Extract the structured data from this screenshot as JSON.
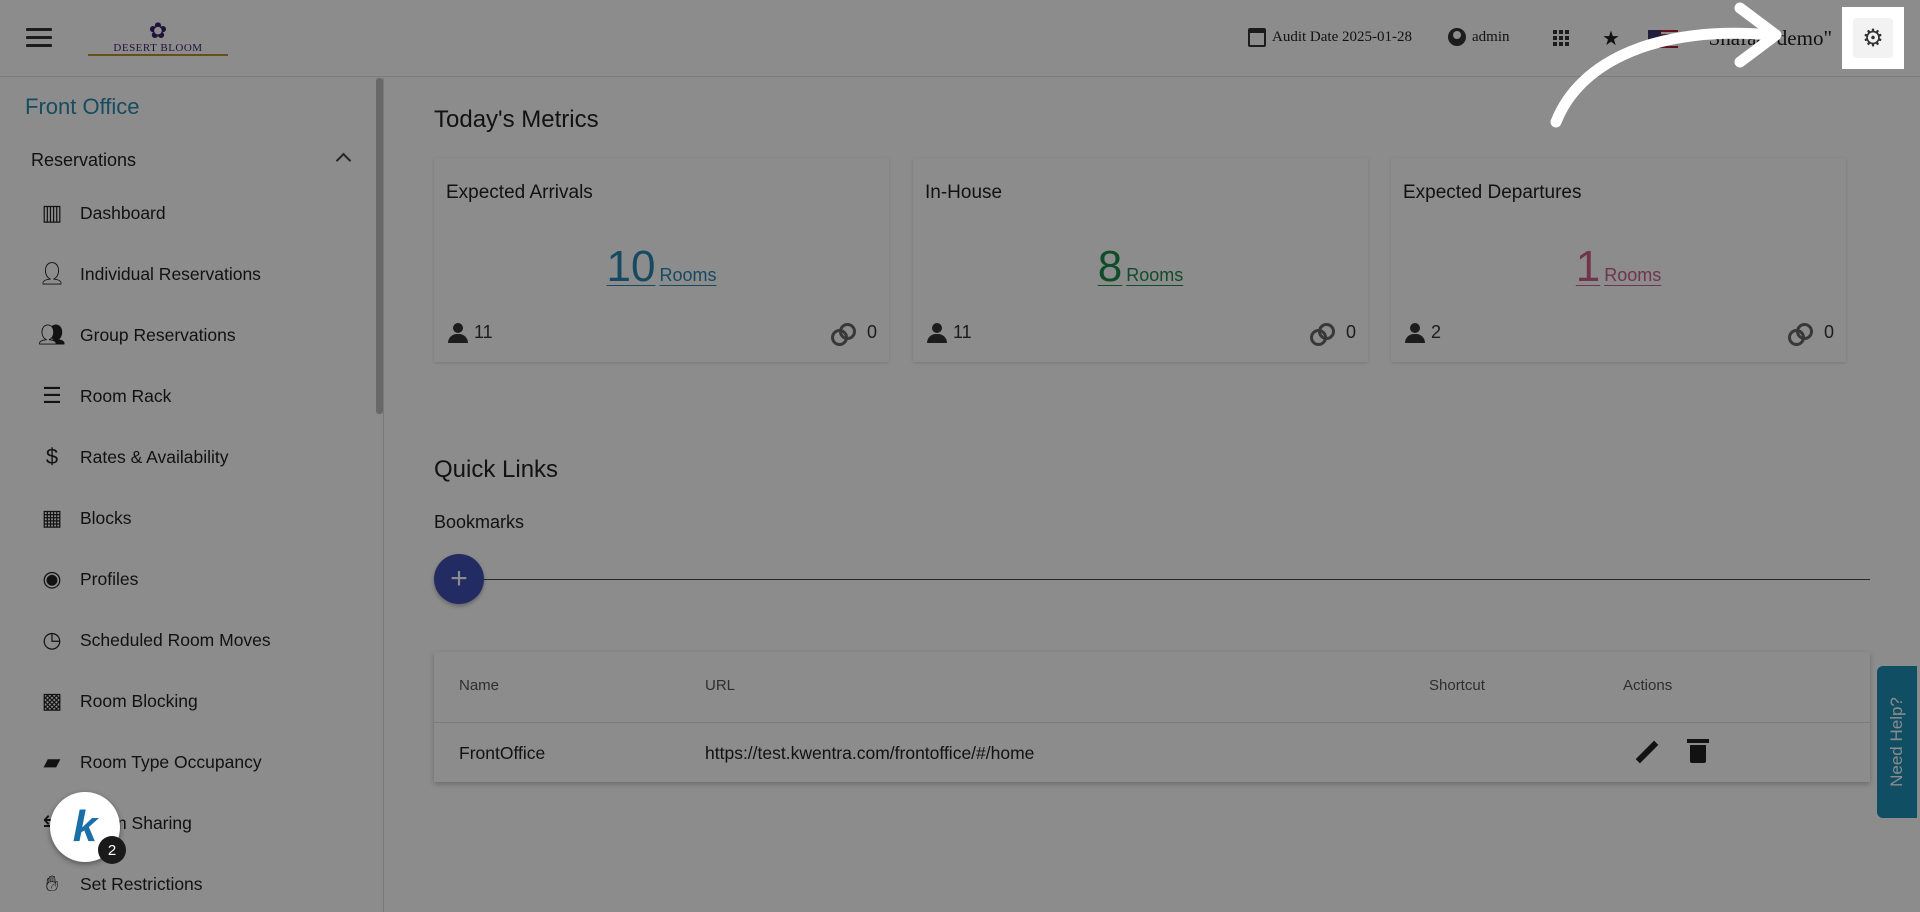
{
  "topbar": {
    "logo_text": "DESERT BLOOM",
    "audit_date": "Audit Date 2025-01-28",
    "user": "admin",
    "company": "\"Shafaat demo\""
  },
  "sidebar": {
    "title": "Front Office",
    "section": "Reservations",
    "items": [
      {
        "label": "Dashboard",
        "icon": "bar-chart-icon"
      },
      {
        "label": "Individual Reservations",
        "icon": "person-icon"
      },
      {
        "label": "Group Reservations",
        "icon": "group-icon"
      },
      {
        "label": "Room Rack",
        "icon": "list-icon"
      },
      {
        "label": "Rates & Availability",
        "icon": "dollar-icon"
      },
      {
        "label": "Blocks",
        "icon": "dashboard-icon"
      },
      {
        "label": "Profiles",
        "icon": "account-circle-icon"
      },
      {
        "label": "Scheduled Room Moves",
        "icon": "clock-icon"
      },
      {
        "label": "Room Blocking",
        "icon": "grid-icon"
      },
      {
        "label": "Room Type Occupancy",
        "icon": "label-icon"
      },
      {
        "label": "Room Sharing",
        "icon": "share-icon"
      },
      {
        "label": "Set Restrictions",
        "icon": "hand-icon"
      }
    ]
  },
  "metrics": {
    "heading": "Today's Metrics",
    "cards": [
      {
        "title": "Expected Arrivals",
        "value": "10",
        "unit": "Rooms",
        "persons": "11",
        "linked": "0",
        "color": "#2b86b5"
      },
      {
        "title": "In-House",
        "value": "8",
        "unit": "Rooms",
        "persons": "11",
        "linked": "0",
        "color": "#1e8a4e"
      },
      {
        "title": "Expected Departures",
        "value": "1",
        "unit": "Rooms",
        "persons": "2",
        "linked": "0",
        "color": "#c8618a"
      }
    ]
  },
  "quick_links": {
    "heading": "Quick Links",
    "bookmarks_label": "Bookmarks",
    "add_label": "+",
    "table": {
      "headers": [
        "Name",
        "URL",
        "Shortcut",
        "Actions"
      ],
      "rows": [
        {
          "name": "FrontOffice",
          "url": "https://test.kwentra.com/frontoffice/#/home",
          "shortcut": ""
        }
      ]
    }
  },
  "help_tab": "Need Help?",
  "assistant": {
    "logo": "k",
    "badge": "2"
  }
}
